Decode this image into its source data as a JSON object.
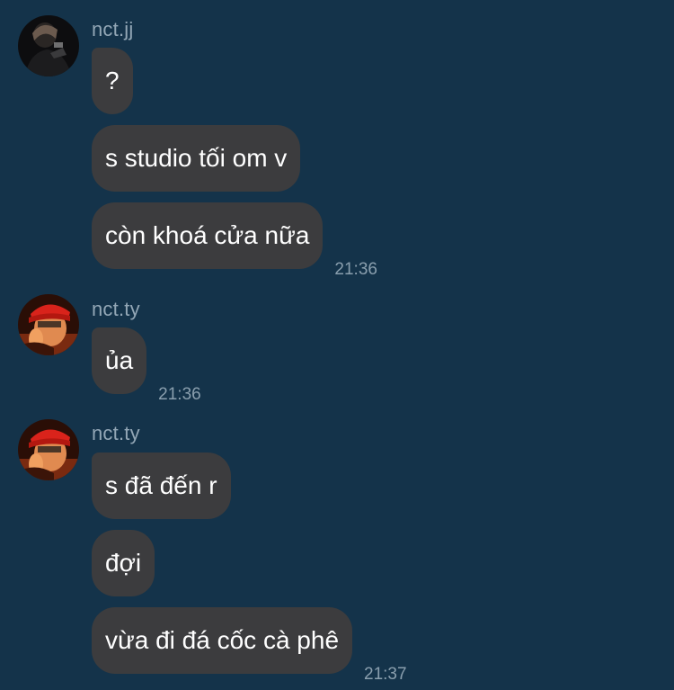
{
  "theme": {
    "background": "#14334a",
    "bubble": "#3c3c3e",
    "text": "#ffffff",
    "meta_text": "#93a7b6"
  },
  "groups": [
    {
      "sender": "nct.jj",
      "avatar_icon": "user-avatar-dark-photo-icon",
      "messages": [
        {
          "text": "?",
          "time": ""
        },
        {
          "text": "s studio tối om v",
          "time": ""
        },
        {
          "text": "còn khoá cửa nữa",
          "time": "21:36"
        }
      ]
    },
    {
      "sender": "nct.ty",
      "avatar_icon": "user-avatar-red-cap-photo-icon",
      "messages": [
        {
          "text": "ủa",
          "time": "21:36"
        }
      ]
    },
    {
      "sender": "nct.ty",
      "avatar_icon": "user-avatar-red-cap-photo-icon",
      "messages": [
        {
          "text": "s đã đến r",
          "time": ""
        },
        {
          "text": "đợi",
          "time": ""
        },
        {
          "text": "vừa đi đá cốc cà phê",
          "time": "21:37"
        }
      ]
    }
  ]
}
